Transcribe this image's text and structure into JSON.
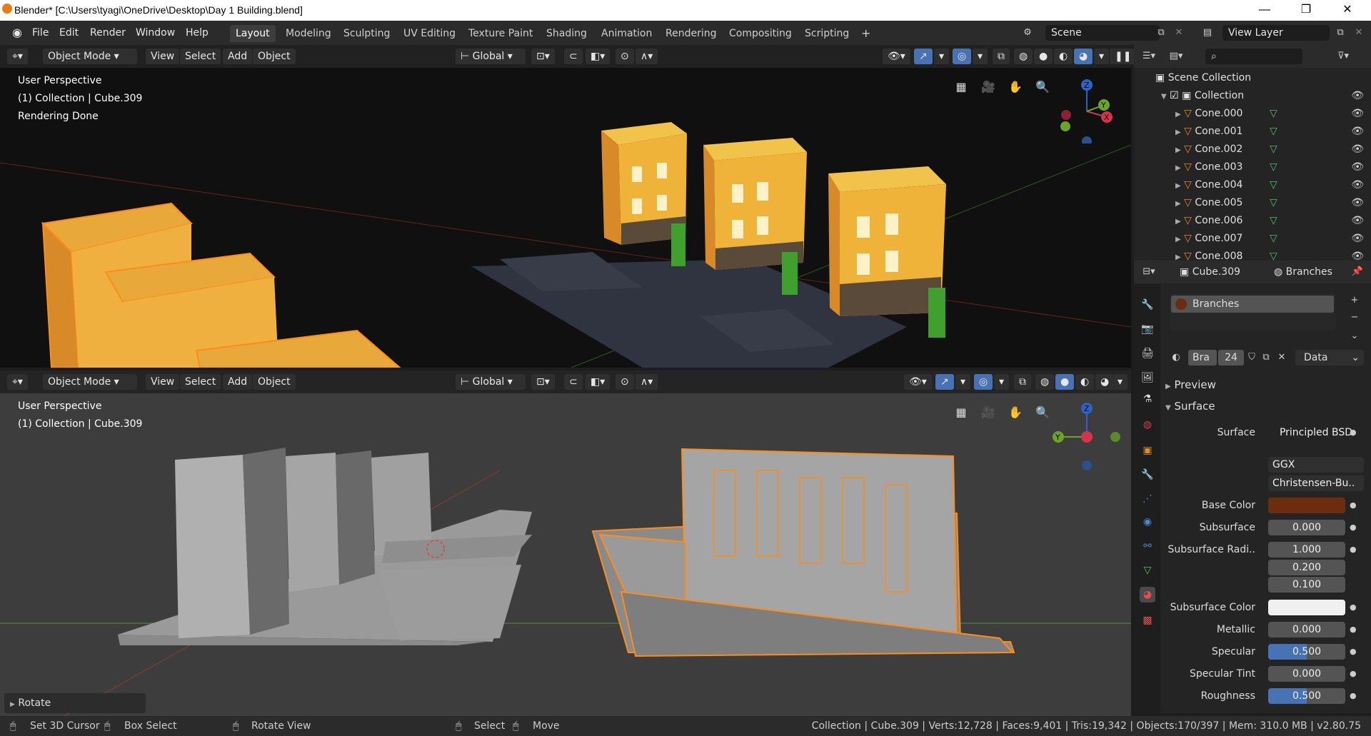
{
  "titlebar": {
    "title": "Blender* [C:\\Users\\tyagi\\OneDrive\\Desktop\\Day 1 Building.blend]",
    "minimize": "—",
    "maximize": "❐",
    "close": "✕"
  },
  "menus": [
    "File",
    "Edit",
    "Render",
    "Window",
    "Help"
  ],
  "workspaces": [
    "Layout",
    "Modeling",
    "Sculpting",
    "UV Editing",
    "Texture Paint",
    "Shading",
    "Animation",
    "Rendering",
    "Compositing",
    "Scripting"
  ],
  "active_workspace": "Layout",
  "scene_name": "Scene",
  "view_layer": "View Layer",
  "viewport_header": {
    "mode": "Object Mode",
    "view": "View",
    "select": "Select",
    "add": "Add",
    "object": "Object",
    "orientation": "Global"
  },
  "top_viewport": {
    "line1": "User Perspective",
    "line2": "(1) Collection | Cube.309",
    "line3": "Rendering Done"
  },
  "bottom_viewport": {
    "line1": "User Perspective",
    "line2": "(1) Collection | Cube.309",
    "operator_panel": "Rotate"
  },
  "gizmo": {
    "z": "Z",
    "y": "Y",
    "x": "X"
  },
  "outliner": {
    "root": "Scene Collection",
    "collection": "Collection",
    "items": [
      "Cone.000",
      "Cone.001",
      "Cone.002",
      "Cone.003",
      "Cone.004",
      "Cone.005",
      "Cone.006",
      "Cone.007",
      "Cone.008"
    ]
  },
  "properties": {
    "object_name": "Cube.309",
    "material_name": "Branches",
    "slot_label": "Branches",
    "mat_short": "Bra",
    "mat_users": "24",
    "link": "Data",
    "preview": "Preview",
    "surface_section": "Surface",
    "rows": [
      {
        "label": "Surface",
        "value": "Principled BSD"
      },
      {
        "label": "",
        "value": "GGX"
      },
      {
        "label": "",
        "value": "Christensen-Bu.."
      },
      {
        "label": "Base Color",
        "value": ""
      },
      {
        "label": "Subsurface",
        "value": "0.000"
      },
      {
        "label": "Subsurface Radi..",
        "value": "1.000"
      },
      {
        "label": "",
        "value": "0.200"
      },
      {
        "label": "",
        "value": "0.100"
      },
      {
        "label": "Subsurface Color",
        "value": ""
      },
      {
        "label": "Metallic",
        "value": "0.000"
      },
      {
        "label": "Specular",
        "value": "0.500"
      },
      {
        "label": "Specular Tint",
        "value": "0.000"
      },
      {
        "label": "Roughness",
        "value": "0.500"
      }
    ],
    "specular_level": 0.5,
    "roughness_level": 0.5,
    "base_color": "#6b2d0e",
    "subsurface_color": "#f0f0f0"
  },
  "status": {
    "set_cursor": "Set 3D Cursor",
    "box_select": "Box Select",
    "rotate_view": "Rotate View",
    "select": "Select",
    "move": "Move",
    "info": "Collection | Cube.309 | Verts:12,728 | Faces:9,401 | Tris:19,342 | Objects:170/397 | Mem: 310.0 MB | v2.80.75"
  },
  "colors": {
    "accent": "#4772b3",
    "selection": "#ff8c1a",
    "building_yellow": "#e8a83a"
  }
}
